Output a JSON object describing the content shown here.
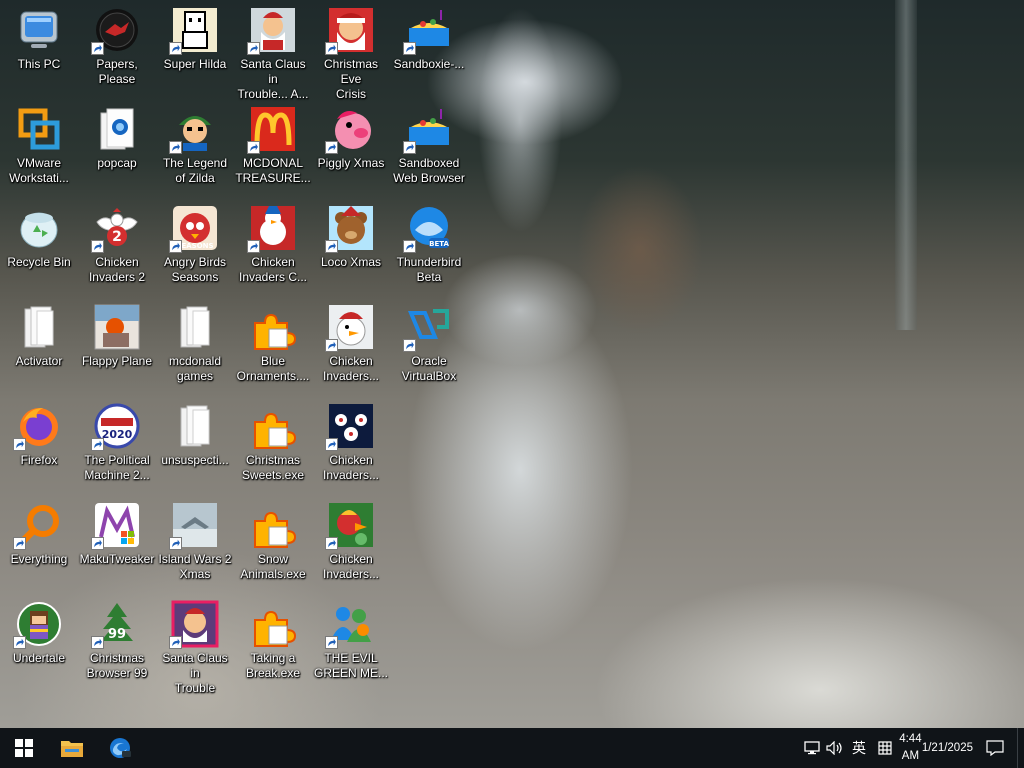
{
  "desktop": {
    "icons": [
      {
        "label": "This PC",
        "icon": "computer-icon"
      },
      {
        "label": "Papers, Please",
        "icon": "papers-please-icon"
      },
      {
        "label": "Super Hilda",
        "icon": "super-hilda-icon"
      },
      {
        "label": "Santa Claus in\nTrouble... A...",
        "icon": "santa-claus-icon"
      },
      {
        "label": "Christmas Eve\nCrisis",
        "icon": "santa-face-icon"
      },
      {
        "label": "Sandboxie-...",
        "icon": "sandboxie-icon"
      },
      {
        "label": "VMware\nWorkstati...",
        "icon": "vmware-icon"
      },
      {
        "label": "popcap",
        "icon": "folder-popcap-icon"
      },
      {
        "label": "The Legend\nof Zilda",
        "icon": "zilda-icon"
      },
      {
        "label": "MCDONAL\nTREASURE...",
        "icon": "mcdonalds-icon"
      },
      {
        "label": "Piggly Xmas",
        "icon": "piggly-icon"
      },
      {
        "label": "Sandboxed\nWeb Browser",
        "icon": "sandboxie-icon"
      },
      {
        "label": "Recycle Bin",
        "icon": "recycle-bin-icon"
      },
      {
        "label": "Chicken\nInvaders 2",
        "icon": "chicken-invaders-2-icon"
      },
      {
        "label": "Angry Birds\nSeasons",
        "icon": "angry-birds-icon"
      },
      {
        "label": "Chicken\nInvaders C...",
        "icon": "snowman-chicken-icon"
      },
      {
        "label": "Loco Xmas",
        "icon": "teddy-bear-icon"
      },
      {
        "label": "Thunderbird\nBeta",
        "icon": "thunderbird-icon"
      },
      {
        "label": "Activator",
        "icon": "folder-icon"
      },
      {
        "label": "Flappy Plane",
        "icon": "flappy-plane-icon"
      },
      {
        "label": "mcdonald\ngames",
        "icon": "folder-icon"
      },
      {
        "label": "Blue\nOrnaments....",
        "icon": "puzzle-exe-icon"
      },
      {
        "label": "Chicken\nInvaders...",
        "icon": "chicken-santa-icon"
      },
      {
        "label": "Oracle\nVirtualBox",
        "icon": "virtualbox-icon"
      },
      {
        "label": "Firefox",
        "icon": "firefox-icon"
      },
      {
        "label": "The Political\nMachine 2...",
        "icon": "political-machine-icon"
      },
      {
        "label": "unsuspecti...",
        "icon": "folder-icon"
      },
      {
        "label": "Christmas\nSweets.exe",
        "icon": "puzzle-exe-icon"
      },
      {
        "label": "Chicken\nInvaders...",
        "icon": "chicken-invaders-space-icon"
      },
      {
        "label": "Everything",
        "icon": "everything-search-icon"
      },
      {
        "label": "MakuTweaker",
        "icon": "makutweaker-icon"
      },
      {
        "label": "Island Wars 2\nXmas",
        "icon": "island-wars-icon"
      },
      {
        "label": "Snow\nAnimals.exe",
        "icon": "puzzle-exe-icon"
      },
      {
        "label": "Chicken\nInvaders...",
        "icon": "chicken-invaders-green-icon"
      },
      {
        "label": "Undertale",
        "icon": "undertale-icon"
      },
      {
        "label": "Christmas\nBrowser 99",
        "icon": "christmas-browser-icon"
      },
      {
        "label": "Santa Claus in\nTrouble",
        "icon": "santa-claus-icon"
      },
      {
        "label": "Taking a\nBreak.exe",
        "icon": "puzzle-exe-icon"
      },
      {
        "label": "THE EVIL\nGREEN ME...",
        "icon": "msn-messenger-icon"
      }
    ]
  },
  "taskbar": {
    "start": "windows-start-icon",
    "pinned": [
      "file-explorer-icon",
      "edge-dev-icon"
    ],
    "tray": {
      "ime_label": "英",
      "time": "4:44 AM",
      "date": "1/21/2025"
    }
  },
  "colors": {
    "taskbar_bg": "#101418",
    "label_text": "#ffffff",
    "accent_blue": "#0078d7"
  }
}
